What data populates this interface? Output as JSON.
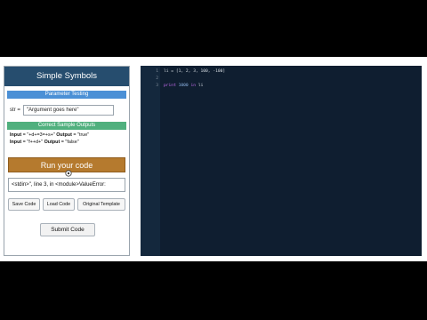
{
  "app": {
    "title": "Simple Symbols"
  },
  "parameters": {
    "header": "Parameter Testing",
    "label": "str =",
    "value": "\"Argument goes here\""
  },
  "samples": {
    "header": "Correct Sample Outputs",
    "rows": [
      {
        "input_label": "Input",
        "input_value": " = \"+d+=3=+s+\" ",
        "output_label": "Output",
        "output_value": " = \"true\""
      },
      {
        "input_label": "Input",
        "input_value": " = \"f++d+\" ",
        "output_label": "Output",
        "output_value": " = \"false\""
      }
    ]
  },
  "run_button": "Run your code",
  "output_text": "<stdin>\", line 3, in <module>ValueError:",
  "buttons": {
    "save": "Save Code",
    "load": "Load Code",
    "template": "Original Template",
    "submit": "Submit Code"
  },
  "editor": {
    "line_numbers": [
      "1",
      "2",
      "3"
    ],
    "line1": "li = [1, 2, 3, 100, -100]",
    "line3_kw1": "print",
    "line3_num": "1000",
    "line3_kw2": "in",
    "line3_var": "li"
  },
  "colors": {
    "title_bar": "#264d6e",
    "param_bar": "#4b90d6",
    "sample_bar": "#50b07e",
    "run_button": "#b57a2e",
    "editor_bg": "#0f1e30"
  }
}
